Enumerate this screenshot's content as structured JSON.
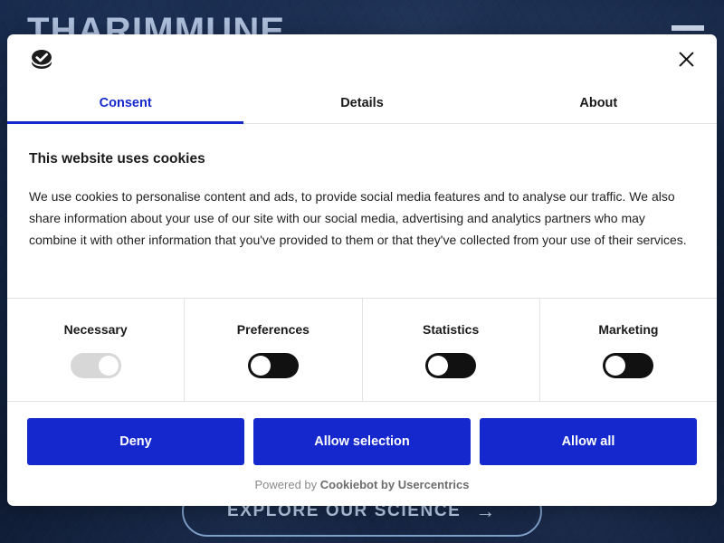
{
  "site": {
    "logo_text": "THARIMMUNE",
    "menu_icon": "hamburger-menu-icon",
    "cta_label": "EXPLORE OUR SCIENCE",
    "cta_arrow": "→",
    "background_color": "#101f3d",
    "accent_color": "#b6cae4"
  },
  "dialog": {
    "logo_icon": "cookiebot-cookie-check-icon",
    "close_icon": "close-icon",
    "close_label": "Close",
    "accent_color": "#1428ce",
    "tabs": [
      {
        "label": "Consent",
        "active": true
      },
      {
        "label": "Details",
        "active": false
      },
      {
        "label": "About",
        "active": false
      }
    ],
    "content": {
      "title": "This website uses cookies",
      "description": "We use cookies to personalise content and ads, to provide social media features and to analyse our traffic. We also share information about your use of our site with our social media, advertising and analytics partners who may combine it with other information that you've provided to them or that they've collected from your use of their services."
    },
    "categories": [
      {
        "label": "Necessary",
        "state": "on-locked"
      },
      {
        "label": "Preferences",
        "state": "off"
      },
      {
        "label": "Statistics",
        "state": "off"
      },
      {
        "label": "Marketing",
        "state": "off"
      }
    ],
    "actions": [
      {
        "label": "Deny"
      },
      {
        "label": "Allow selection"
      },
      {
        "label": "Allow all"
      }
    ],
    "footer": {
      "prefix": "Powered by ",
      "brand": "Cookiebot by Usercentrics"
    }
  }
}
